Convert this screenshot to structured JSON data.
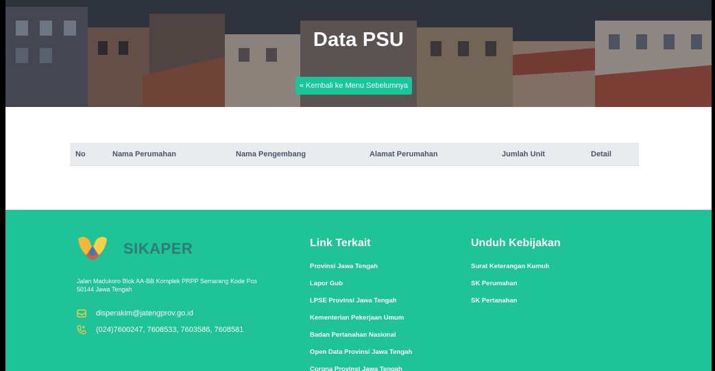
{
  "hero": {
    "title": "Data PSU",
    "back_button": "« Kembali ke Menu Sebelumnya"
  },
  "table": {
    "columns": [
      "No",
      "Nama Perumahan",
      "Nama Pengembang",
      "Alamat Perumahan",
      "Jumlah Unit",
      "Detail"
    ]
  },
  "footer": {
    "brand": "SIKAPER",
    "address": "Jalan Madukoro Blok AA-BB Komplek PRPP Semarang Kode Pos 50144 Jawa Tengah",
    "email": "disperakim@jatengprov.go.id",
    "phone": "(024)7600247, 7608533, 7603586, 7608581",
    "links_title": "Link Terkait",
    "links": [
      "Provinsi Jawa Tengah",
      "Lapor Gub",
      "LPSE Provinsi Jawa Tengah",
      "Kementerian Pekerjaan Umum",
      "Badan Pertanahan Nasional",
      "Open Data Provinsi Jawa Tengah",
      "Corona Provinsi Jawa Tengah"
    ],
    "downloads_title": "Unduh Kebijakan",
    "downloads": [
      "Surat Keterangan Kumuh",
      "SK Perumahan",
      "SK Pertanahan"
    ]
  },
  "colors": {
    "accent": "#16c79a",
    "footer_bg": "#1ec497",
    "table_header_bg": "#e9ecef"
  }
}
